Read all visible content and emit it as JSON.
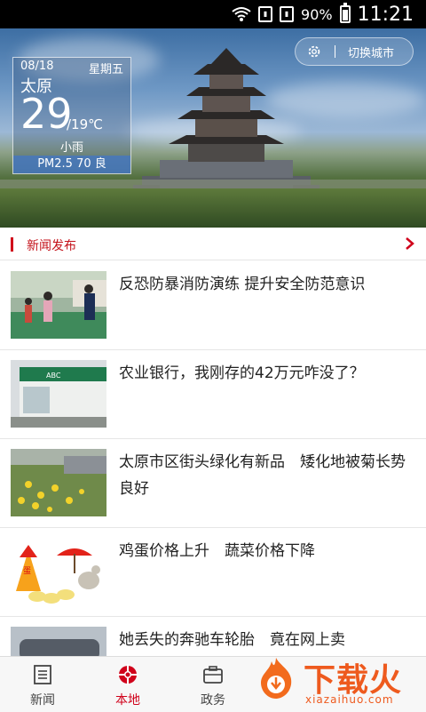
{
  "status_bar": {
    "battery": "90%",
    "time": "11:21"
  },
  "weather": {
    "date": "08/18",
    "weekday": "星期五",
    "city": "太原",
    "temp_high": "29",
    "temp_low": "/19℃",
    "condition": "小雨",
    "air_quality": "PM2.5 70 良"
  },
  "switch_city": {
    "label": "切换城市"
  },
  "section": {
    "title": "新闻发布"
  },
  "news": [
    {
      "title": "反恐防暴消防演练 提升安全防范意识"
    },
    {
      "title": "农业银行，我刚存的42万元咋没了？"
    },
    {
      "title": "太原市区街头绿化有新品　矮化地被菊长势良好"
    },
    {
      "title": "鸡蛋价格上升　蔬菜价格下降"
    },
    {
      "title": "她丢失的奔驰车轮胎　竟在网上卖"
    }
  ],
  "tabs": [
    {
      "label": "新闻"
    },
    {
      "label": "本地"
    },
    {
      "label": "政务"
    }
  ],
  "watermark": {
    "cn": "下载火",
    "en": "xiazaihuo.com"
  },
  "colors": {
    "accent": "#d0021b",
    "watermark": "#ee5a1e"
  }
}
